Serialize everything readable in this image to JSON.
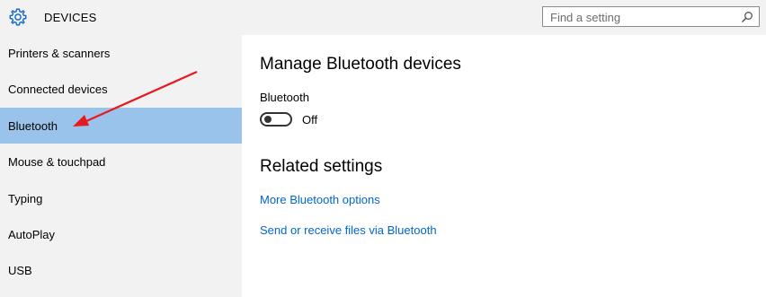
{
  "header": {
    "title": "DEVICES",
    "icon": "gear-icon",
    "search": {
      "placeholder": "Find a setting",
      "icon": "search-icon"
    }
  },
  "sidebar": {
    "items": [
      {
        "label": "Printers & scanners",
        "selected": false
      },
      {
        "label": "Connected devices",
        "selected": false
      },
      {
        "label": "Bluetooth",
        "selected": true
      },
      {
        "label": "Mouse & touchpad",
        "selected": false
      },
      {
        "label": "Typing",
        "selected": false
      },
      {
        "label": "AutoPlay",
        "selected": false
      },
      {
        "label": "USB",
        "selected": false
      }
    ],
    "selected_color": "#99c3ea"
  },
  "main": {
    "manage_title": "Manage Bluetooth devices",
    "bluetooth_label": "Bluetooth",
    "bluetooth_state": "Off",
    "related_title": "Related settings",
    "links": [
      {
        "label": "More Bluetooth options"
      },
      {
        "label": "Send or receive files via Bluetooth"
      }
    ],
    "link_color": "#0066cc"
  },
  "annotation": {
    "color": "#e8191e"
  }
}
